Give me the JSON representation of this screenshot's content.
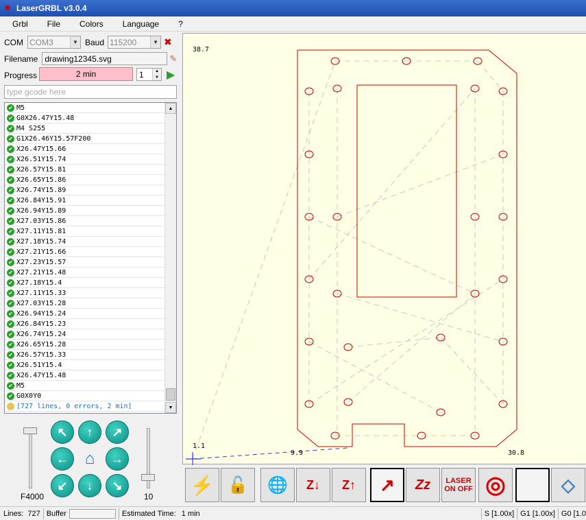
{
  "window": {
    "title": "LaserGRBL v3.0.4"
  },
  "menu": [
    "Grbl",
    "File",
    "Colors",
    "Language",
    "?"
  ],
  "connection": {
    "com_label": "COM",
    "com_value": "COM3",
    "baud_label": "Baud",
    "baud_value": "115200"
  },
  "file": {
    "filename_label": "Filename",
    "filename_value": "drawing12345.svg"
  },
  "progress": {
    "label": "Progress",
    "time_text": "2 min",
    "passes": "1"
  },
  "gcode_input": {
    "placeholder": "type gcode here"
  },
  "gcode_lines": [
    "M5",
    "G0X26.47Y15.48",
    "M4 S255",
    "G1X26.46Y15.57F200",
    "X26.47Y15.66",
    "X26.51Y15.74",
    "X26.57Y15.81",
    "X26.65Y15.86",
    "X26.74Y15.89",
    "X26.84Y15.91",
    "X26.94Y15.89",
    "X27.03Y15.86",
    "X27.11Y15.81",
    "X27.18Y15.74",
    "X27.21Y15.66",
    "X27.23Y15.57",
    "X27.21Y15.48",
    "X27.18Y15.4",
    "X27.11Y15.33",
    "X27.03Y15.28",
    "X26.94Y15.24",
    "X26.84Y15.23",
    "X26.74Y15.24",
    "X26.65Y15.28",
    "X26.57Y15.33",
    "X26.51Y15.4",
    "X26.47Y15.48",
    "M5",
    "G0X0Y0"
  ],
  "gcode_summary": "[727 lines, 0 errors, 2 min]",
  "jog": {
    "arrows": [
      "↖",
      "↑",
      "↗",
      "←",
      "→",
      "↙",
      "↓",
      "↘"
    ],
    "speed_label": "F4000",
    "step_label": "10"
  },
  "preview": {
    "y_max_label": "38.7",
    "origin_label": "1.1",
    "x_mid_label": "9.9",
    "x_max_label": "30.8"
  },
  "toolbar": {
    "buttons": [
      {
        "name": "lightning-icon",
        "glyph": "⚡"
      },
      {
        "name": "unlock-icon",
        "glyph": "🔓"
      },
      {
        "name": "globe-pin-icon",
        "glyph": "🌐"
      },
      {
        "name": "z-down-icon",
        "glyph": "Z↓"
      },
      {
        "name": "z-up-icon",
        "glyph": "Z↑"
      },
      {
        "name": "arrow-frame-icon",
        "glyph": "↗"
      },
      {
        "name": "sleep-icon",
        "glyph": "Zz"
      },
      {
        "name": "laser-on-off-icon",
        "glyph": "LASER ON OFF"
      },
      {
        "name": "target-icon",
        "glyph": "◎"
      },
      {
        "name": "blank-icon",
        "glyph": ""
      },
      {
        "name": "eraser-icon",
        "glyph": "◇"
      }
    ]
  },
  "status": {
    "lines_label": "Lines:",
    "lines_value": "727",
    "buffer_label": "Buffer",
    "est_label": "Estimated Time:",
    "est_value": "1 min",
    "s_override": "S [1.00x]",
    "g1_override": "G1 [1.00x]",
    "g0_override": "G0 [1.0"
  },
  "colors": {
    "cut_red": "#cc0000",
    "preview_bg": "#ffffe6",
    "progress_pink": "#ffc0cb",
    "jog_teal": "#14a99e"
  }
}
